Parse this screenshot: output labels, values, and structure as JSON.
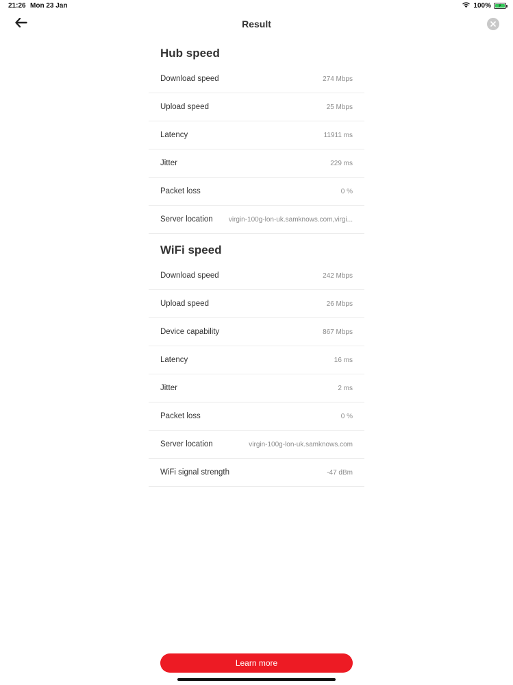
{
  "status_bar": {
    "time": "21:26",
    "date": "Mon 23 Jan",
    "battery": "100%",
    "icons": [
      "wifi-icon",
      "battery-charging-icon"
    ]
  },
  "nav": {
    "title": "Result",
    "back_icon": "arrow-left-icon",
    "close_icon": "close-circle-icon"
  },
  "hub_speed": {
    "title": "Hub speed",
    "rows": [
      {
        "label": "Download speed",
        "value": "274 Mbps"
      },
      {
        "label": "Upload speed",
        "value": "25 Mbps"
      },
      {
        "label": "Latency",
        "value": "11911 ms"
      },
      {
        "label": "Jitter",
        "value": "229 ms"
      },
      {
        "label": "Packet loss",
        "value": "0 %"
      },
      {
        "label": "Server location",
        "value": "virgin-100g-lon-uk.samknows.com,virgi..."
      }
    ]
  },
  "wifi_speed": {
    "title": "WiFi speed",
    "rows": [
      {
        "label": "Download speed",
        "value": "242 Mbps"
      },
      {
        "label": "Upload speed",
        "value": "26 Mbps"
      },
      {
        "label": "Device capability",
        "value": "867 Mbps"
      },
      {
        "label": "Latency",
        "value": "16 ms"
      },
      {
        "label": "Jitter",
        "value": "2 ms"
      },
      {
        "label": "Packet loss",
        "value": "0 %"
      },
      {
        "label": "Server location",
        "value": "virgin-100g-lon-uk.samknows.com"
      },
      {
        "label": "WiFi signal strength",
        "value": "-47 dBm"
      }
    ]
  },
  "learn_more_label": "Learn more",
  "colors": {
    "accent": "#ed1b24",
    "battery": "#34c759"
  }
}
